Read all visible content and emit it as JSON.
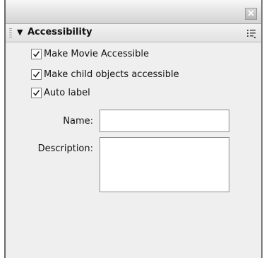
{
  "window": {
    "close_glyph": "×"
  },
  "panel": {
    "collapse_glyph": "▼",
    "title": "Accessibility"
  },
  "checkboxes": [
    {
      "label": "Make Movie Accessible",
      "checked": true
    },
    {
      "label": "Make child objects accessible",
      "checked": true
    },
    {
      "label": "Auto label",
      "checked": true
    }
  ],
  "fields": {
    "name_label": "Name:",
    "name_value": "",
    "description_label": "Description:",
    "description_value": ""
  },
  "colors": {
    "panel_bg": "#efefef",
    "input_bg": "#ffffff"
  }
}
